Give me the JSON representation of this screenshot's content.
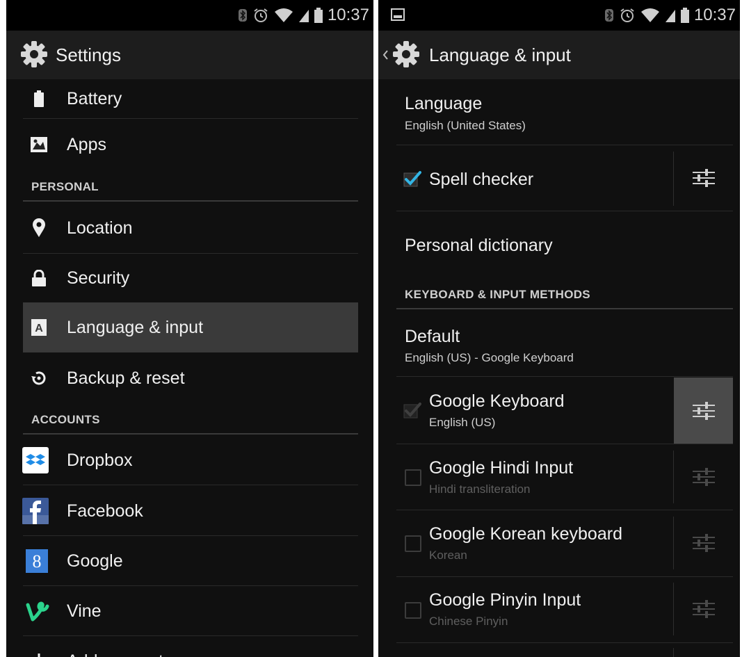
{
  "status": {
    "time": "10:37"
  },
  "left": {
    "title": "Settings",
    "items_top": [
      {
        "label": "Battery",
        "icon": "battery-icon"
      },
      {
        "label": "Apps",
        "icon": "apps-icon"
      }
    ],
    "section_personal": "PERSONAL",
    "items_personal": [
      {
        "label": "Location",
        "icon": "location-icon"
      },
      {
        "label": "Security",
        "icon": "lock-icon"
      },
      {
        "label": "Language & input",
        "icon": "language-icon"
      },
      {
        "label": "Backup & reset",
        "icon": "backup-icon"
      }
    ],
    "section_accounts": "ACCOUNTS",
    "items_accounts": [
      {
        "label": "Dropbox",
        "icon": "dropbox-icon"
      },
      {
        "label": "Facebook",
        "icon": "facebook-icon"
      },
      {
        "label": "Google",
        "icon": "google-icon"
      },
      {
        "label": "Vine",
        "icon": "vine-icon"
      },
      {
        "label": "Add account",
        "icon": "plus-icon"
      }
    ]
  },
  "right": {
    "title": "Language & input",
    "language": {
      "title": "Language",
      "summary": "English (United States)"
    },
    "spell_checker": {
      "title": "Spell checker",
      "checked": true
    },
    "personal_dictionary": "Personal dictionary",
    "section_keyboard": "KEYBOARD & INPUT METHODS",
    "default": {
      "title": "Default",
      "summary": "English (US) - Google Keyboard"
    },
    "methods": [
      {
        "title": "Google Keyboard",
        "summary": "English (US)",
        "checked": true,
        "enabled": false
      },
      {
        "title": "Google Hindi Input",
        "summary": "Hindi transliteration",
        "checked": false,
        "enabled": false
      },
      {
        "title": "Google Korean keyboard",
        "summary": "Korean",
        "checked": false,
        "enabled": false
      },
      {
        "title": "Google Pinyin Input",
        "summary": "Chinese Pinyin",
        "checked": false,
        "enabled": false
      }
    ]
  },
  "colors": {
    "accent": "#33b5e5",
    "background": "#101010",
    "action_bar": "#1d1d1d",
    "selected": "#3a3a3a"
  }
}
